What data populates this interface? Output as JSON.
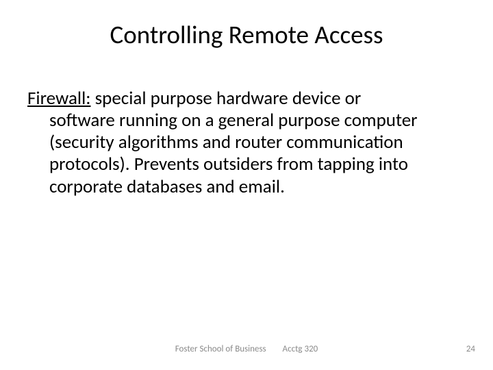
{
  "title": "Controlling Remote Access",
  "body": {
    "term": "Firewall:",
    "rest_first_line": "  special purpose hardware device or",
    "continuation": "software running on a general purpose computer (security algorithms and router communication protocols).  Prevents outsiders from tapping into corporate databases and email."
  },
  "footer": {
    "left_center": "Foster School of Business",
    "right_center": "Acctg 320",
    "page_number": "24"
  }
}
